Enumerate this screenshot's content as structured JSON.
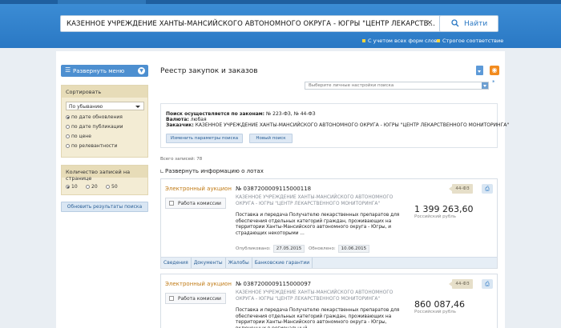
{
  "header": {
    "search_value": "КАЗЕННОЕ УЧРЕЖДЕНИЕ ХАНТЫ-МАНСИЙСКОГО АВТОНОМНОГО ОКРУГА - ЮГРЫ \"ЦЕНТР ЛЕКАРСТВ...",
    "clear_glyph": "×",
    "search_button": "Найти",
    "option_all_forms": "С учетом всех форм слов",
    "option_strict": "Строгое соответствие"
  },
  "sidebar": {
    "menu_button": "Развернуть меню",
    "sort_title": "Сортировать",
    "sort_select": "По убыванию",
    "sort_options": [
      "по дате обновления",
      "по дате публикации",
      "по цене",
      "по релевантности"
    ],
    "sort_selected_index": 0,
    "page_size_title": "Количество записей на странице",
    "page_sizes": [
      "10",
      "20",
      "50"
    ],
    "page_size_selected_index": 0,
    "refresh_button": "Обновить результаты поиска"
  },
  "main": {
    "title": "Реестр закупок и заказов",
    "settings_placeholder": "Выберите личные настройки поиска",
    "star": "*",
    "params": {
      "laws_label": "Поиск осуществляется по законам:",
      "laws_value": "№ 223-ФЗ, № 44-ФЗ",
      "currency_label": "Валюта:",
      "currency_value": "любая",
      "customer_label": "Заказчик:",
      "customer_value": "КАЗЕННОЕ УЧРЕЖДЕНИЕ ХАНТЫ-МАНСИЙСКОГО АВТОНОМНОГО ОКРУГА - ЮГРЫ \"ЦЕНТР ЛЕКАРСТВЕННОГО МОНИТОРИНГА\"",
      "change_button": "Изменить параметры поиска",
      "new_search_button": "Новый поиск"
    },
    "total": "Всего записей: 78",
    "expand_lots": "Развернуть информацию о лотах"
  },
  "results": [
    {
      "type": "Электронный аукцион",
      "commission": "Работа комиссии",
      "number": "№ 0387200009115000118",
      "customer": "КАЗЕННОЕ УЧРЕЖДЕНИЕ ХАНТЫ-МАНСИЙСКОГО АВТОНОМНОГО ОКРУГА - ЮГРЫ \"ЦЕНТР ЛЕКАРСТВЕННОГО МОНИТОРИНГА\"",
      "description": "Поставка и передача Получателю лекарственных препаратов для обеспечения отдельных категорий граждан, проживающих на территории Ханты-Мансийского автономного округа - Югры, и страдающих некоторыми ...",
      "published_label": "Опубликовано:",
      "published": "27.05.2015",
      "updated_label": "Обновлено:",
      "updated": "10.06.2015",
      "law": "44-ФЗ",
      "price": "1 399 263,60",
      "currency": "Российский рубль",
      "tabs": [
        "Сведения",
        "Документы",
        "Жалобы",
        "Банковские гарантии"
      ]
    },
    {
      "type": "Электронный аукцион",
      "commission": "Работа комиссии",
      "number": "№ 0387200009115000097",
      "customer": "КАЗЕННОЕ УЧРЕЖДЕНИЕ ХАНТЫ-МАНСИЙСКОГО АВТОНОМНОГО ОКРУГА - ЮГРЫ \"ЦЕНТР ЛЕКАРСТВЕННОГО МОНИТОРИНГА\"",
      "description": "Поставка и передача Получателю лекарственных препаратов для обеспечения отдельных категорий граждан, проживающих на территории Ханты-Мансийского автономного округа - Югры, включенных в региональный",
      "law": "44-ФЗ",
      "price": "860 087,46",
      "currency": "Российский рубль"
    }
  ],
  "colors": {
    "header_blue": "#2a78c4",
    "accent_orange": "#c07a14",
    "sidebar_beige": "#f3ecd4",
    "rss_orange": "#f28b1e"
  },
  "icons": [
    "search-icon",
    "close-icon",
    "menu-icon",
    "chevron-down-icon",
    "download-icon",
    "rss-icon",
    "print-icon",
    "checkbox-icon"
  ]
}
